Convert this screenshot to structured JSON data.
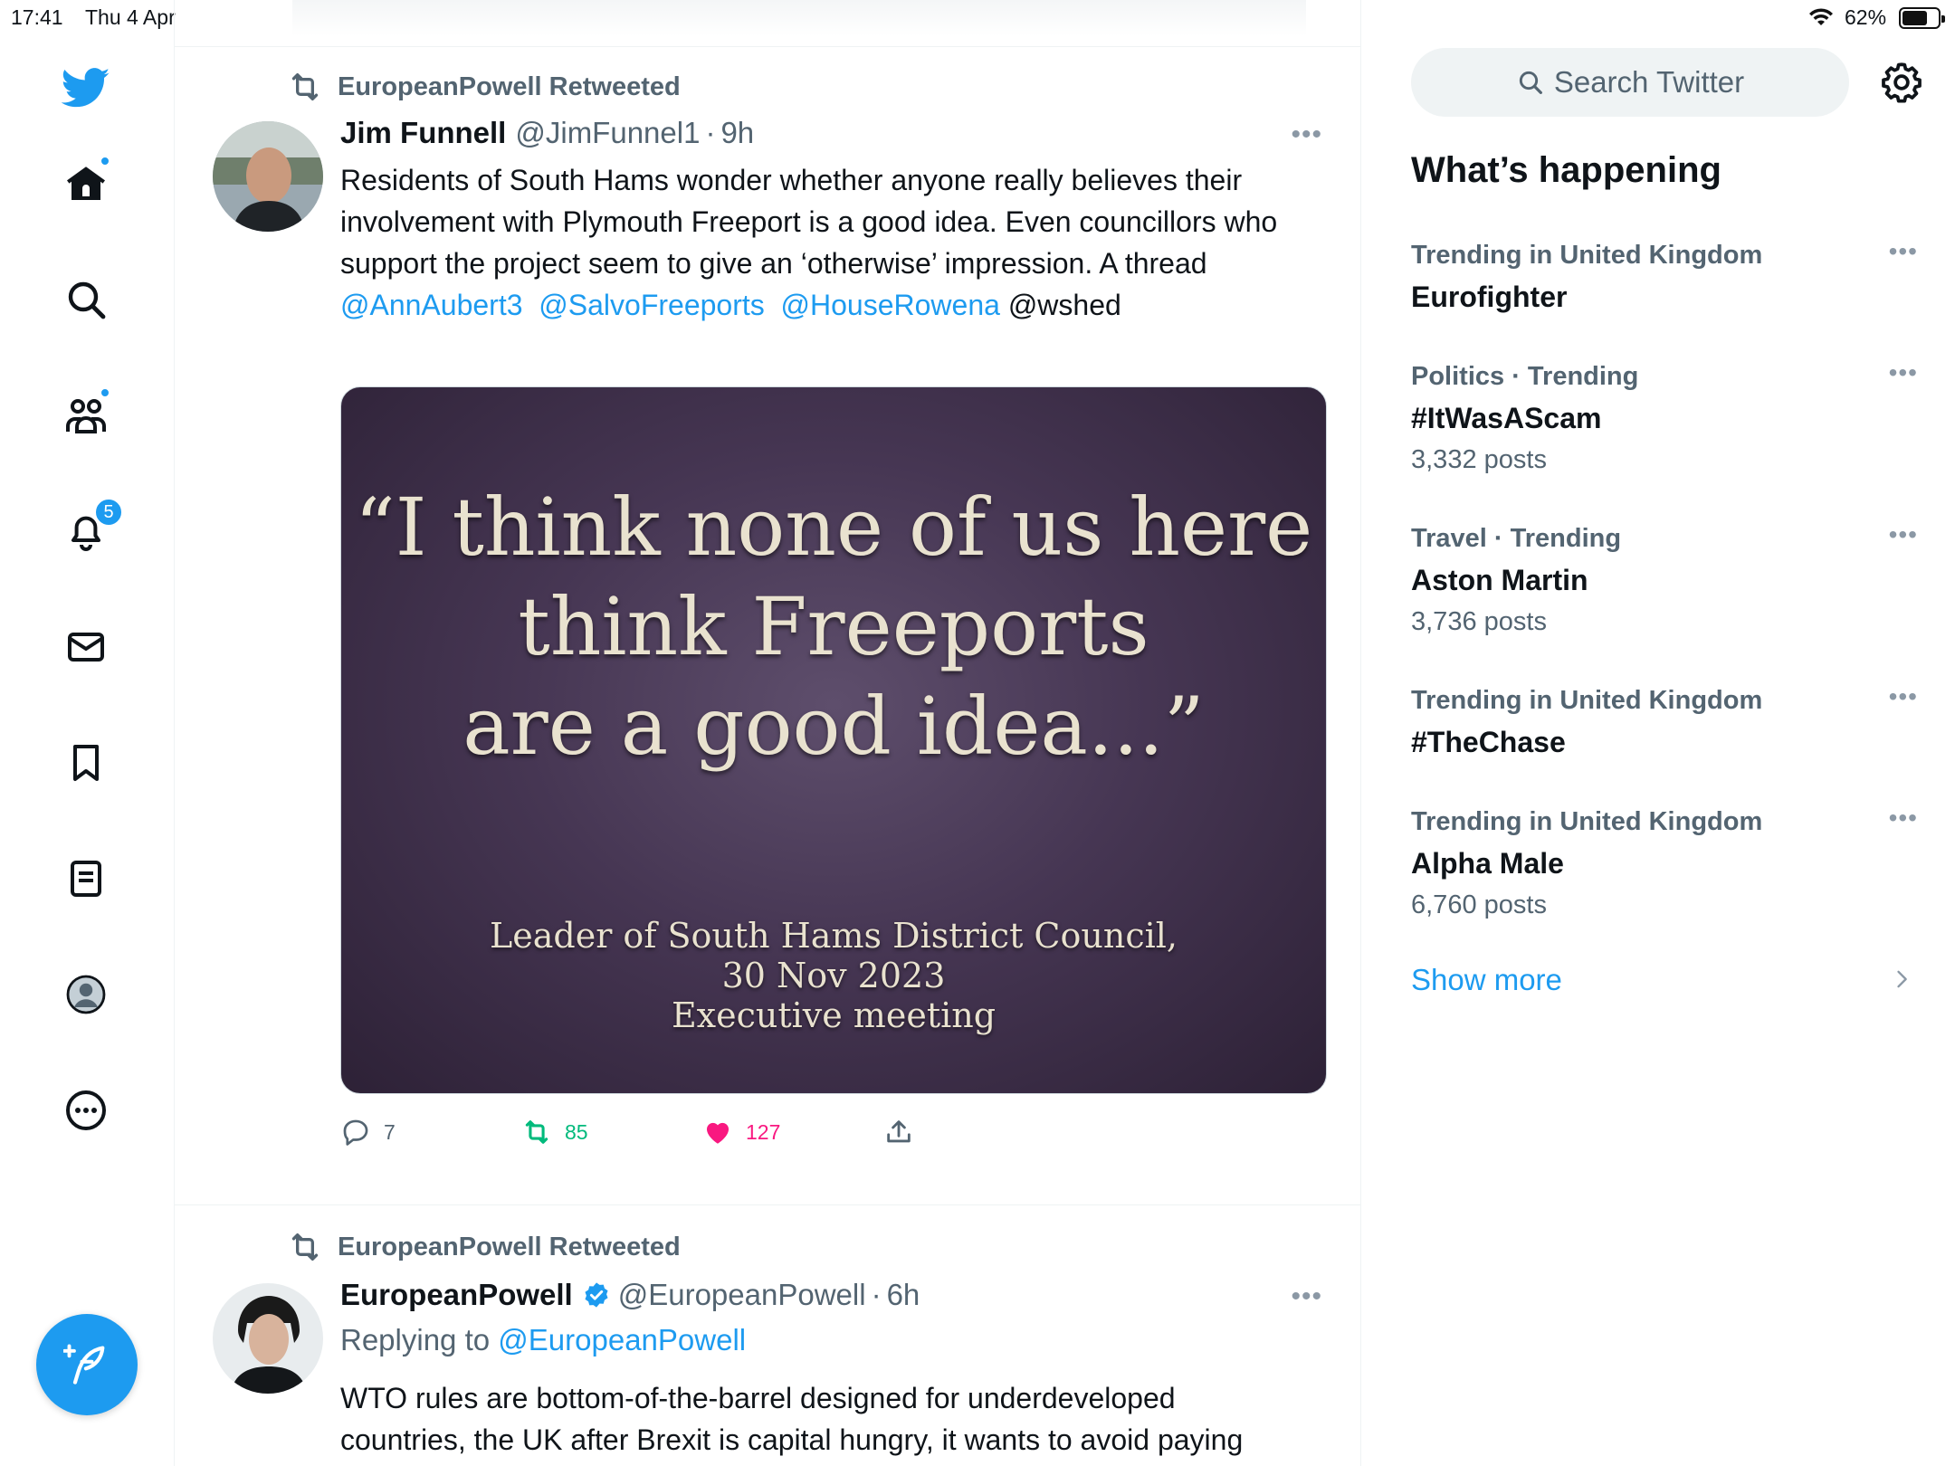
{
  "status_bar": {
    "time": "17:41",
    "date": "Thu 4 Apr",
    "battery": "62%"
  },
  "nav": {
    "notifications_badge": "5"
  },
  "colors": {
    "accent": "#1d9bf0",
    "retweet": "#00ba7c",
    "like": "#f91880",
    "secondary_text": "#536471"
  },
  "tweets": [
    {
      "retweet_context": "EuropeanPowell Retweeted",
      "author_name": "Jim Funnell",
      "author_handle": "@JimFunnel1",
      "separator": "·",
      "time": "9h",
      "text": "Residents of South Hams wonder whether anyone really believes their involvement with Plymouth Freeport is a good idea. Even councillors who support the project seem to give an ‘otherwise’ impression. A thread",
      "mentions": [
        "@AnnAubert3",
        "@SalvoFreeports",
        "@HouseRowena"
      ],
      "plain_mention": "@wshed",
      "media": {
        "quote_lines": [
          "“I think none of us here",
          "think Freeports",
          "are a good idea...”"
        ],
        "caption_lines": [
          "Leader of South Hams District Council,",
          "30 Nov 2023",
          "Executive meeting"
        ]
      },
      "reply_count": "7",
      "retweet_count": "85",
      "like_count": "127"
    },
    {
      "retweet_context": "EuropeanPowell Retweeted",
      "author_name": "EuropeanPowell",
      "author_handle": "@EuropeanPowell",
      "separator": "·",
      "time": "6h",
      "replying_label": "Replying to",
      "replying_to": "@EuropeanPowell",
      "text": "WTO rules are bottom-of-the-barrel designed for underdeveloped countries, the UK after Brexit is capital hungry, it wants to avoid paying"
    }
  ],
  "search": {
    "placeholder": "Search Twitter"
  },
  "trends_section": {
    "title": "What’s happening",
    "items": [
      {
        "context": "Trending in United Kingdom",
        "name": "Eurofighter",
        "posts": ""
      },
      {
        "context": "Politics · Trending",
        "name": "#ItWasAScam",
        "posts": "3,332 posts"
      },
      {
        "context": "Travel · Trending",
        "name": "Aston Martin",
        "posts": "3,736 posts"
      },
      {
        "context": "Trending in United Kingdom",
        "name": "#TheChase",
        "posts": ""
      },
      {
        "context": "Trending in United Kingdom",
        "name": "Alpha Male",
        "posts": "6,760 posts"
      }
    ],
    "show_more": "Show more"
  }
}
